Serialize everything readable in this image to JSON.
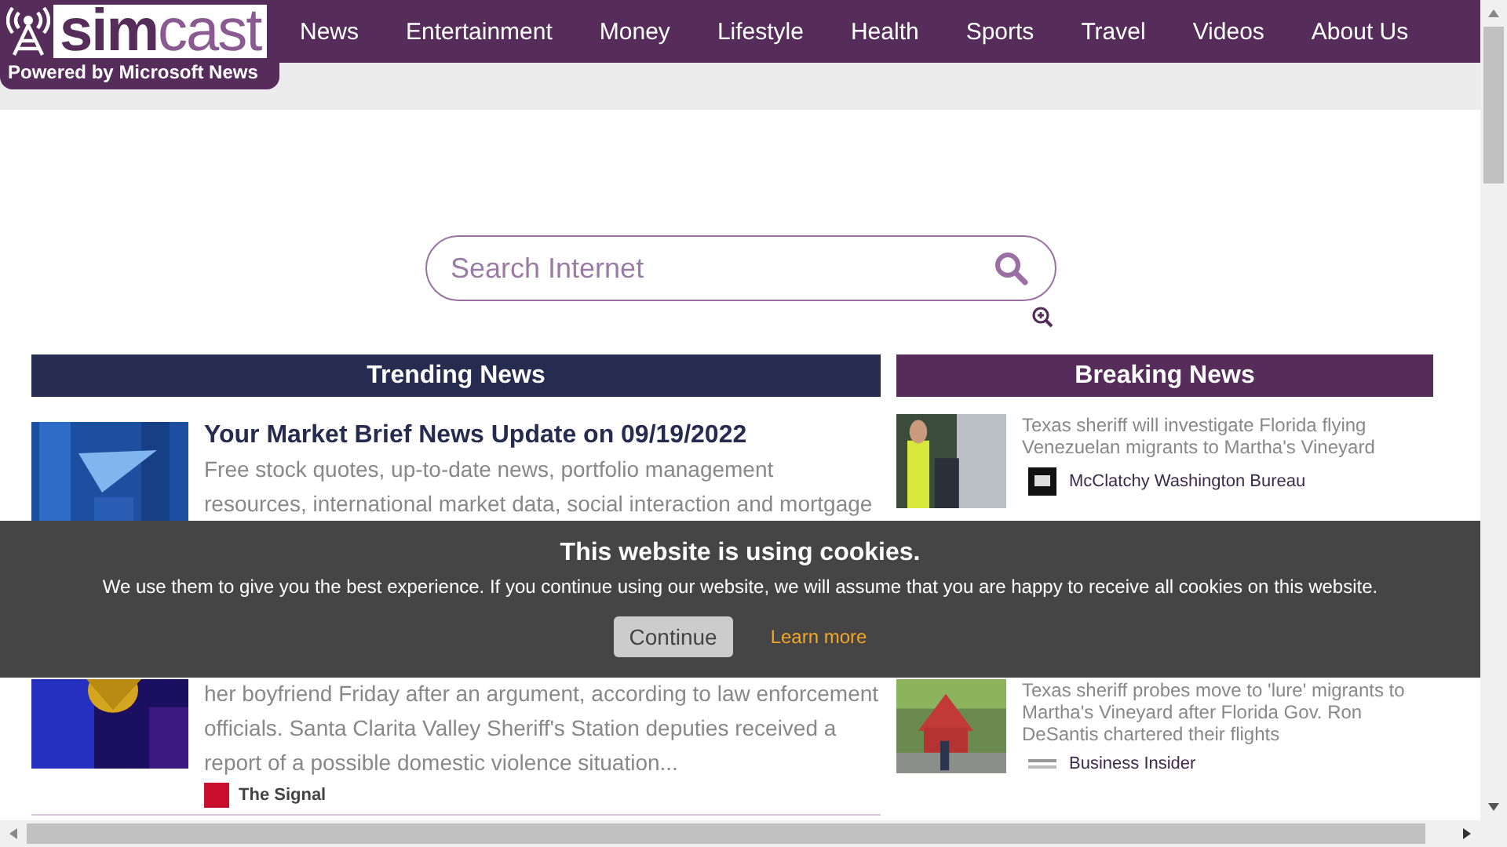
{
  "header": {
    "logo": {
      "wordmark_strong": "sim",
      "wordmark_light": "cast",
      "tagline": "Powered by **Microsoft News**"
    },
    "nav": [
      "News",
      "Entertainment",
      "Money",
      "Lifestyle",
      "Health",
      "Sports",
      "Travel",
      "Videos",
      "About Us"
    ]
  },
  "search": {
    "placeholder": "Search Internet"
  },
  "trending": {
    "title": "Trending News",
    "items": [
      {
        "title": "Your Market Brief News Update on 09/19/2022",
        "summary": "Free stock quotes, up-to-date news, portfolio management resources, international market data, social interaction and mortgage",
        "kind": "top"
      },
      {
        "summary": "her boyfriend Friday after an argument, according to law enforcement officials. Santa Clarita Valley Sheriff's Station deputies received a report of a possible domestic violence situation...",
        "source": "The Signal",
        "kind": "cut"
      }
    ]
  },
  "breaking": {
    "title": "Breaking News",
    "items": [
      {
        "title": "Texas sheriff will investigate Florida flying Venezuelan migrants to Martha's Vineyard",
        "source": "McClatchy Washington Bureau"
      },
      {
        "title": "Texas sheriff probes move to 'lure' migrants to Martha's Vineyard after Florida Gov. Ron DeSantis chartered their flights",
        "source": "Business Insider"
      }
    ]
  },
  "cookie_banner": {
    "title": "This website is using cookies.",
    "message": "We use them to give you the best experience. If you continue using our website, we will assume that you are happy to receive all cookies on this website.",
    "accept_button": "Continue",
    "link": "Learn more"
  }
}
